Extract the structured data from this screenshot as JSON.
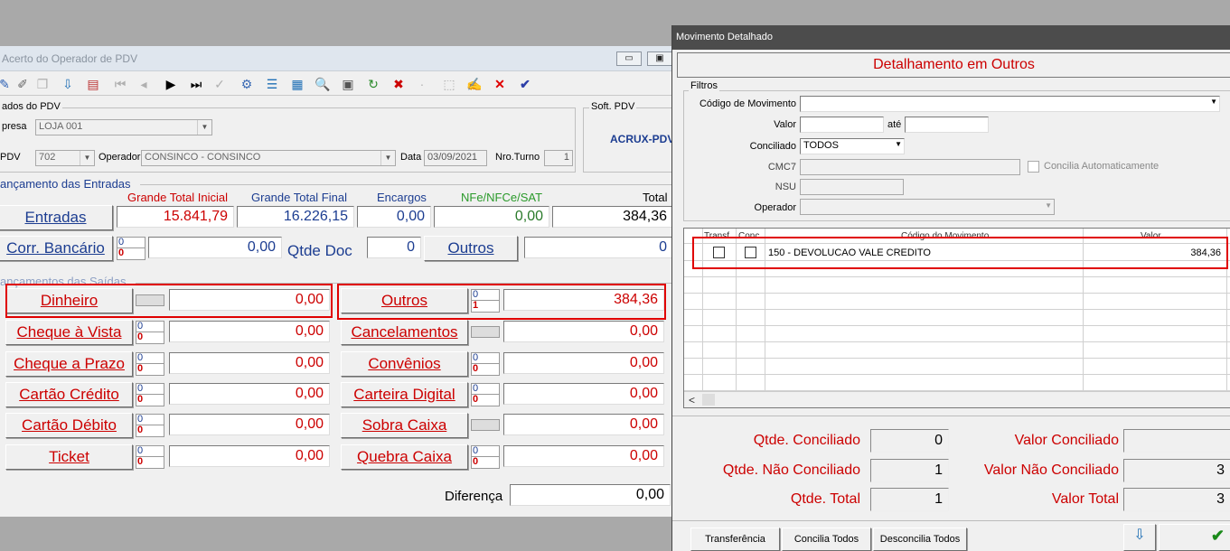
{
  "left_window": {
    "title": "Acerto do Operador de PDV",
    "window_buttons": [
      "▭",
      "▣"
    ],
    "dados_pdv": {
      "group_label": "ados do PDV",
      "empresa_label": "presa",
      "empresa_value": "LOJA 001",
      "pdv_label": "PDV",
      "pdv_value": "702",
      "operador_label": "Operador",
      "operador_value": "CONSINCO - CONSINCO",
      "data_label": "Data",
      "data_value": "03/09/2021",
      "nro_turno_label": "Nro.Turno",
      "nro_turno_value": "1"
    },
    "soft_pdv": {
      "group_label": "Soft. PDV",
      "value": "ACRUX-PDV"
    },
    "entradas": {
      "section_label": "ançamento das Entradas",
      "headers": {
        "grande_total_inicial": "Grande Total Inicial",
        "grande_total_final": "Grande Total Final",
        "encargos": "Encargos",
        "nfe": "NFe/NFCe/SAT",
        "total": "Total"
      },
      "entradas_button": "Entradas",
      "grande_total_inicial": "15.841,79",
      "grande_total_final": "16.226,15",
      "encargos": "0,00",
      "nfe": "0,00",
      "total": "384,36",
      "corr_bancario_button": "Corr. Bancário",
      "corr_count_top": "0",
      "corr_count_bottom": "0",
      "corr_value": "0,00",
      "qtde_doc_label": "Qtde Doc",
      "qtde_doc_value": "0",
      "outros_button": "Outros",
      "outros_value": "0"
    },
    "saidas": {
      "section_label": "ançamentos das Saídas",
      "left_rows": [
        {
          "label": "Dinheiro",
          "top": "",
          "bottom": "",
          "value": "0,00"
        },
        {
          "label": "Cheque à Vista",
          "top": "0",
          "bottom": "0",
          "value": "0,00"
        },
        {
          "label": "Cheque a Prazo",
          "top": "0",
          "bottom": "0",
          "value": "0,00"
        },
        {
          "label": "Cartão Crédito",
          "top": "0",
          "bottom": "0",
          "value": "0,00"
        },
        {
          "label": "Cartão Débito",
          "top": "0",
          "bottom": "0",
          "value": "0,00"
        },
        {
          "label": "Ticket",
          "top": "0",
          "bottom": "0",
          "value": "0,00"
        }
      ],
      "right_rows": [
        {
          "label": "Outros",
          "top": "0",
          "bottom": "1",
          "value": "384,36"
        },
        {
          "label": "Cancelamentos",
          "top": "",
          "bottom": "",
          "value": "0,00"
        },
        {
          "label": "Convênios",
          "top": "0",
          "bottom": "0",
          "value": "0,00"
        },
        {
          "label": "Carteira Digital",
          "top": "0",
          "bottom": "0",
          "value": "0,00"
        },
        {
          "label": "Sobra Caixa",
          "top": "",
          "bottom": "",
          "value": "0,00"
        },
        {
          "label": "Quebra Caixa",
          "top": "0",
          "bottom": "0",
          "value": "0,00"
        }
      ],
      "diferenca_label": "Diferença",
      "diferenca_value": "0,00"
    }
  },
  "right_window": {
    "title": "Movimento Detalhado",
    "heading": "Detalhamento em Outros",
    "filters": {
      "group_label": "Filtros",
      "codigo_label": "Código de Movimento",
      "codigo_value": "",
      "valor_label": "Valor",
      "ate_label": "até",
      "conciliado_label": "Conciliado",
      "conciliado_value": "TODOS",
      "cmc7_label": "CMC7",
      "concilia_auto_label": "Concilia Automaticamente",
      "nsu_label": "NSU",
      "operador_label": "Operador"
    },
    "grid": {
      "headers": [
        "Transf.",
        "Conc",
        "Código do Movimento",
        "Valor"
      ],
      "rows": [
        {
          "codigo": "150 - DEVOLUCAO VALE CREDITO",
          "valor": "384,36"
        }
      ],
      "scroll_left": "<"
    },
    "summary": {
      "qtde_conciliado_label": "Qtde. Conciliado",
      "qtde_conciliado": "0",
      "qtde_nao_conciliado_label": "Qtde. Não Conciliado",
      "qtde_nao_conciliado": "1",
      "qtde_total_label": "Qtde. Total",
      "qtde_total": "1",
      "valor_conciliado_label": "Valor Conciliado",
      "valor_conciliado": "",
      "valor_nao_conciliado_label": "Valor Não Conciliado",
      "valor_nao_conciliado": "3",
      "valor_total_label": "Valor Total",
      "valor_total": "3"
    },
    "buttons": {
      "transferencia": "Transferência",
      "concilia_todos": "Concilia Todos",
      "desconcilia_todos": "Desconcilia Todos"
    }
  }
}
